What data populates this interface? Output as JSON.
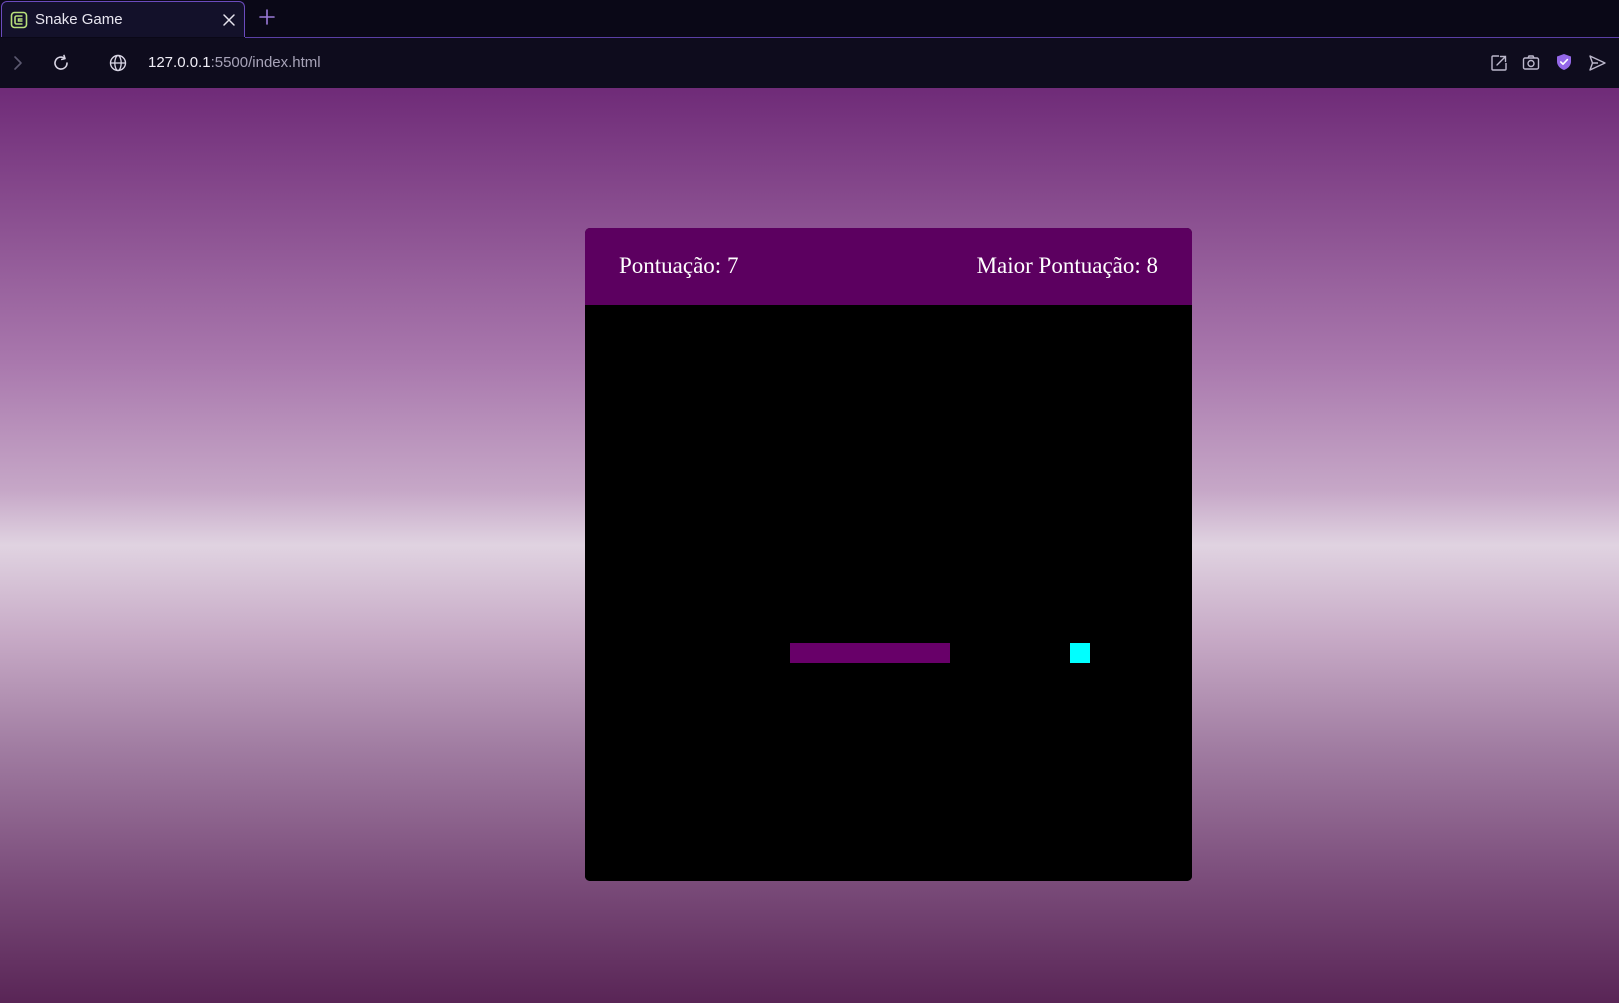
{
  "browser": {
    "tab": {
      "title": "Snake Game",
      "favicon": "app-logo-icon",
      "close_icon": "close-icon"
    },
    "new_tab_icon": "plus-icon",
    "nav": {
      "forward_icon": "chevron-right-icon",
      "reload_icon": "reload-icon",
      "site_info_icon": "globe-icon"
    },
    "address": {
      "host": "127.0.0.1",
      "rest": ":5500/index.html"
    },
    "toolbar_icons": [
      "share-edit-icon",
      "camera-icon",
      "shield-icon",
      "send-icon"
    ]
  },
  "game": {
    "score_text": "Pontuação: 7",
    "high_score_text": "Maior Pontuação: 8",
    "colors": {
      "header": "#5c0060",
      "board": "#000000",
      "snake": "#680069",
      "food": "#00ffff"
    },
    "snake_cells": [
      [
        11,
        17
      ],
      [
        12,
        17
      ],
      [
        13,
        17
      ],
      [
        14,
        17
      ],
      [
        15,
        17
      ],
      [
        16,
        17
      ],
      [
        17,
        17
      ],
      [
        18,
        17
      ]
    ],
    "food_cell": [
      25,
      17
    ]
  }
}
